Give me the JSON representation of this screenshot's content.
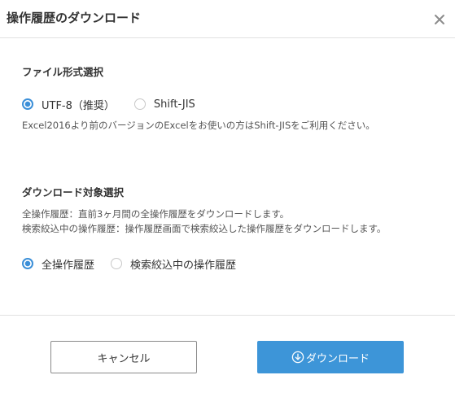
{
  "dialog": {
    "title": "操作履歴のダウンロード",
    "close_icon": "close-icon"
  },
  "file_format": {
    "section_title": "ファイル形式選択",
    "options": [
      {
        "label": "UTF-8（推奨）",
        "selected": true
      },
      {
        "label": "Shift-JIS",
        "selected": false
      }
    ],
    "note": "Excel2016より前のバージョンのExcelをお使いの方はShift-JISをご利用ください。"
  },
  "target": {
    "section_title": "ダウンロード対象選択",
    "description_lines": [
      "全操作履歴：直前3ヶ月間の全操作履歴をダウンロードします。",
      "検索絞込中の操作履歴：操作履歴画面で検索絞込した操作履歴をダウンロードします。"
    ],
    "options": [
      {
        "label": "全操作履歴",
        "selected": true
      },
      {
        "label": "検索絞込中の操作履歴",
        "selected": false
      }
    ]
  },
  "footer": {
    "cancel_label": "キャンセル",
    "download_label": "ダウンロード",
    "download_icon": "download-circle-icon"
  },
  "colors": {
    "accent": "#3d95d8",
    "radio_selected": "#3b8fd8",
    "border": "#e1e1e1"
  }
}
